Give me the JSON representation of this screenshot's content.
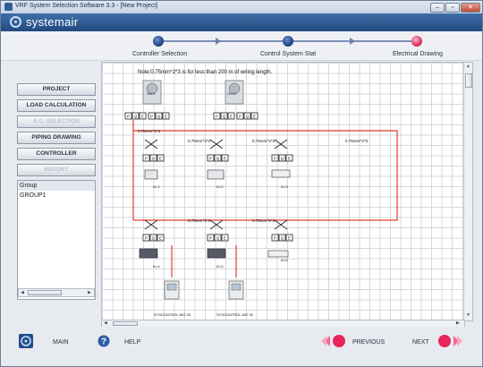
{
  "window": {
    "title": "VRF System Selection Software 3.3 - [New Project]",
    "minimize": "–",
    "restore": "▫",
    "close": "✕"
  },
  "brand": {
    "name": "systemair"
  },
  "steps": [
    {
      "label": "Controller Selection",
      "state": "done"
    },
    {
      "label": "Control System Stat",
      "state": "done"
    },
    {
      "label": "Electrical Drawing",
      "state": "active"
    }
  ],
  "nav": [
    {
      "label": "PROJECT",
      "enabled": true
    },
    {
      "label": "LOAD CALCULATION",
      "enabled": true
    },
    {
      "label": "A.C. SELECTION",
      "enabled": false
    },
    {
      "label": "PIPING DRAWING",
      "enabled": true
    },
    {
      "label": "CONTROLLER",
      "enabled": true
    },
    {
      "label": "REPORT",
      "enabled": false
    }
  ],
  "groups": {
    "header": "Group",
    "items": [
      "GROUP1"
    ]
  },
  "drawing": {
    "note": "Note:0.75mm^2*3 is for less than 200 m of wiring length.",
    "wire_labels": [
      "0.75mm^2*3",
      "0.75mm^2*3",
      "0.75mm^2*3",
      "0.75mm^2*3",
      "0.75mm^2*3",
      "0.75mm^2*3"
    ],
    "outdoor_units": [
      "OU-1",
      "OU-2"
    ],
    "indoor_units": [
      "IU-1",
      "IU-2",
      "IU-3",
      "IU-4",
      "IU-5",
      "IU-6"
    ],
    "controllers": [
      "SYSCONTROL WO 30",
      "SYSCONTROL WO 30"
    ],
    "terminal_letters": [
      "P",
      "Q",
      "E"
    ],
    "colors": {
      "wire": "#e23b2e",
      "comm": "#1a1a1a"
    }
  },
  "bottom": {
    "main": "MAIN",
    "help": "HELP",
    "previous": "PREVIOUS",
    "next": "NEXT"
  }
}
